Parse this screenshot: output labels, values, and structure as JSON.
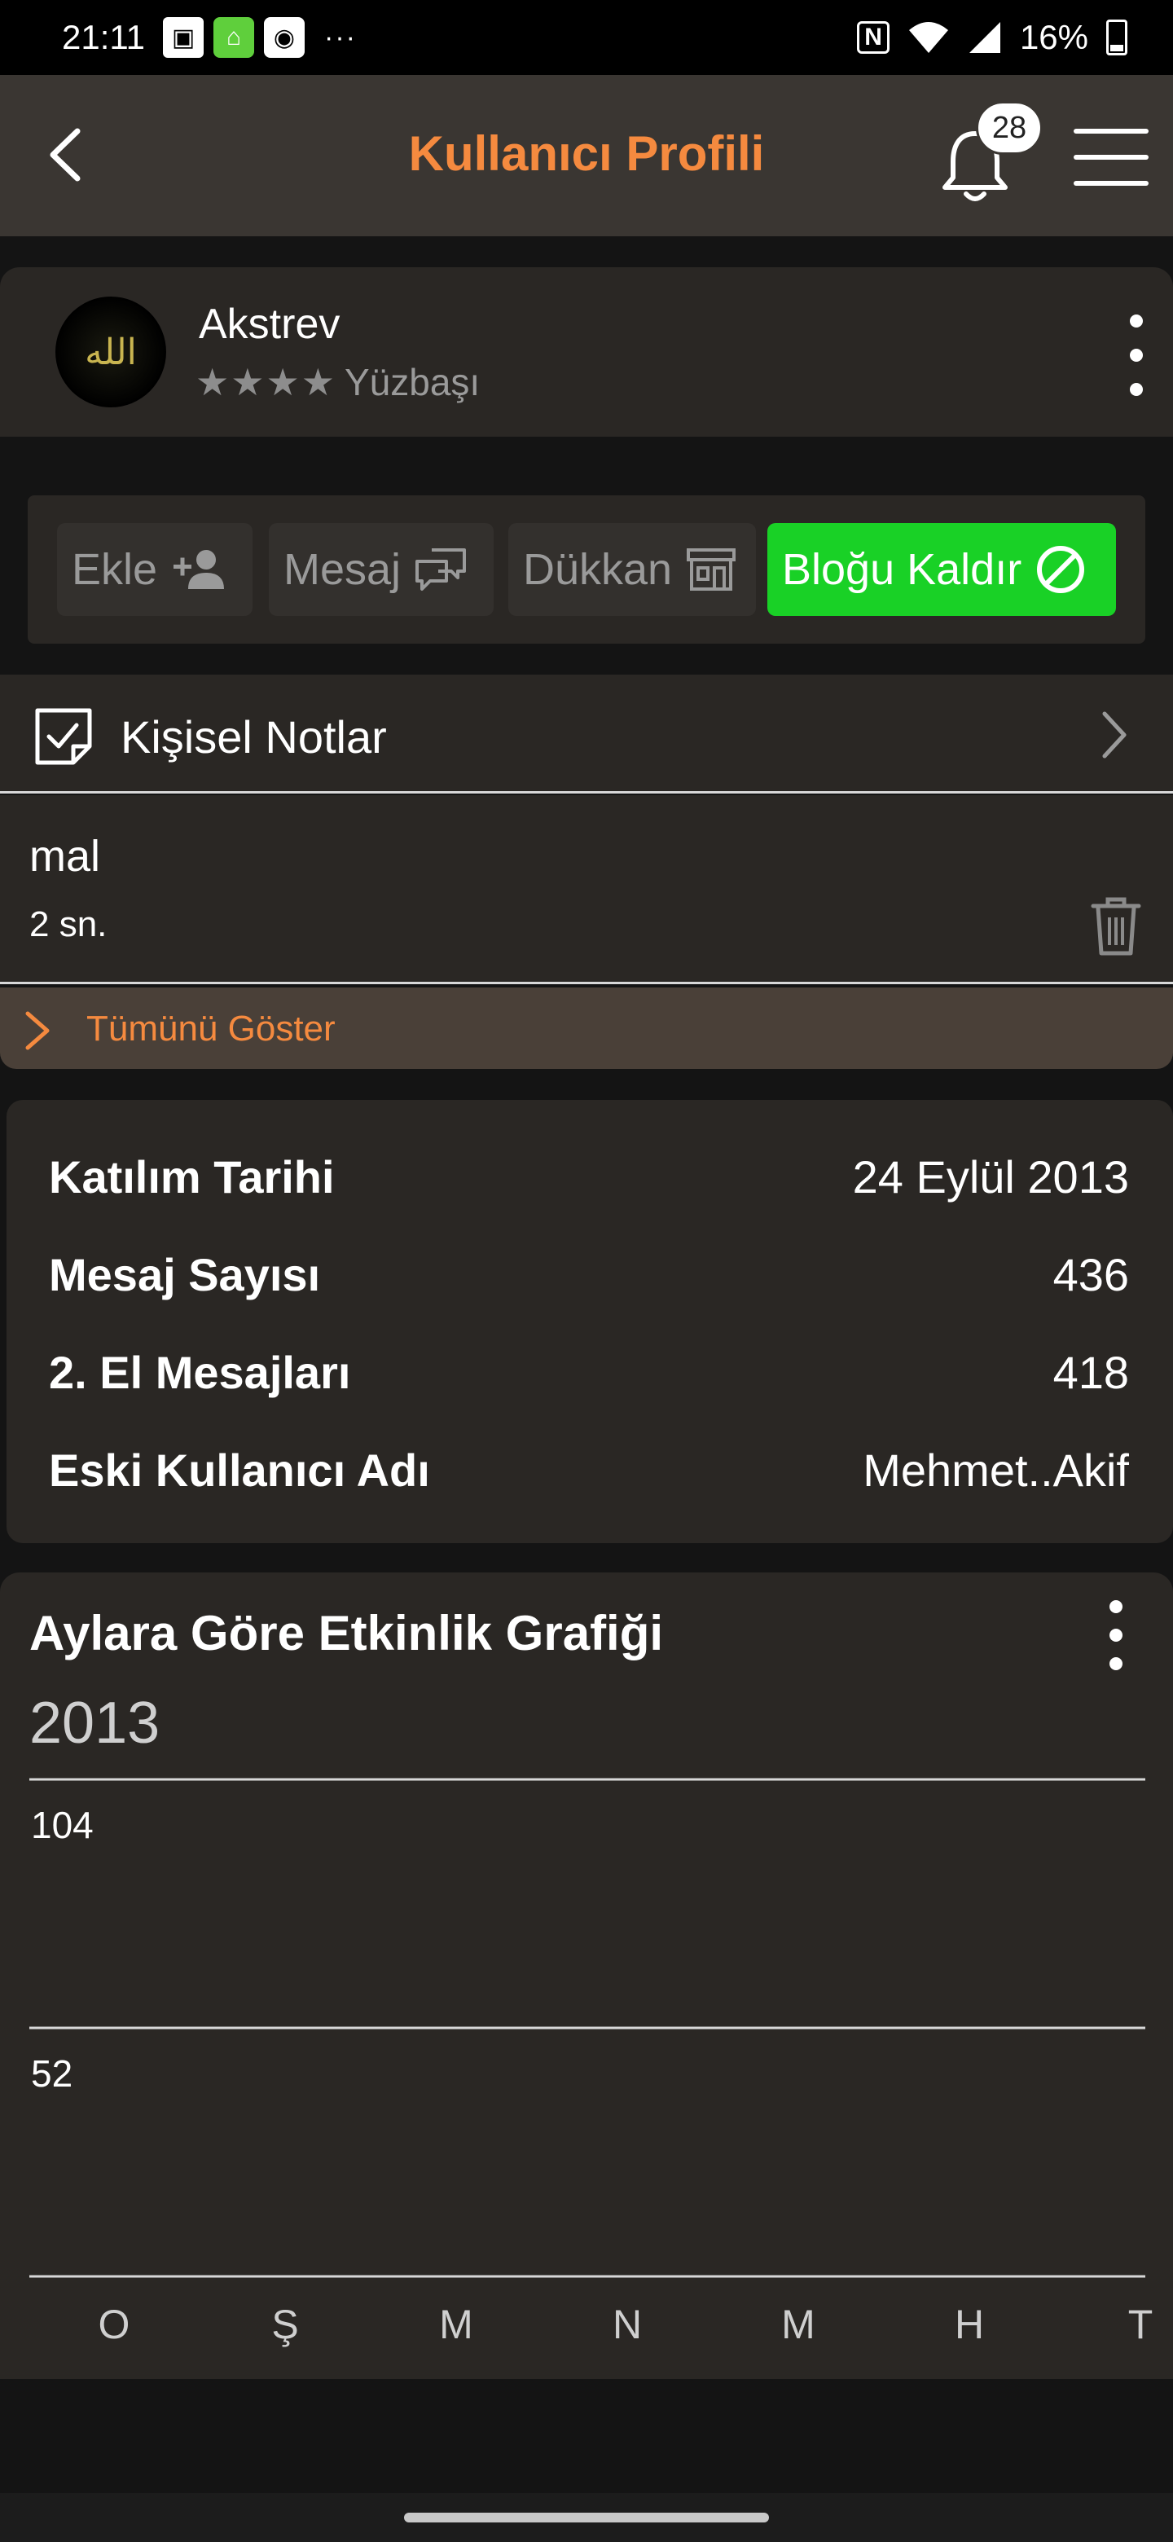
{
  "status_bar": {
    "time": "21:11",
    "left_icons": [
      "box-icon",
      "home-app-icon",
      "camera-app-icon"
    ],
    "more": "···",
    "nfc": "N",
    "battery": "16%"
  },
  "app_bar": {
    "title": "Kullanıcı Profili",
    "notification_count": "28"
  },
  "user": {
    "avatar_text": "الله",
    "name": "Akstrev",
    "stars": 4,
    "rank": "Yüzbaşı"
  },
  "actions": {
    "add_label": "Ekle",
    "message_label": "Mesaj",
    "shop_label": "Dükkan",
    "unblock_label": "Bloğu Kaldır"
  },
  "notes": {
    "title": "Kişisel Notlar",
    "items": [
      {
        "text": "mal",
        "time": "2 sn."
      }
    ],
    "show_all": "Tümünü Göster"
  },
  "stats": [
    {
      "label": "Katılım Tarihi",
      "value": "24 Eylül 2013"
    },
    {
      "label": "Mesaj Sayısı",
      "value": "436"
    },
    {
      "label": "2. El Mesajları",
      "value": "418"
    },
    {
      "label": "Eski Kullanıcı Adı",
      "value": "Mehmet..Akif"
    }
  ],
  "colors": {
    "accent": "#f58a3f",
    "success": "#19d126",
    "card": "#2a2724",
    "appbar": "#3a3632"
  },
  "chart_data": {
    "type": "bar",
    "title": "Aylara Göre Etkinlik Grafiği",
    "year": "2013",
    "y_ticks": [
      "104",
      "52"
    ],
    "ylim": [
      0,
      104
    ],
    "categories": [
      "O",
      "Ş",
      "M",
      "N",
      "M",
      "H",
      "T"
    ],
    "values": [
      0,
      0,
      0,
      0,
      0,
      0,
      0
    ]
  }
}
